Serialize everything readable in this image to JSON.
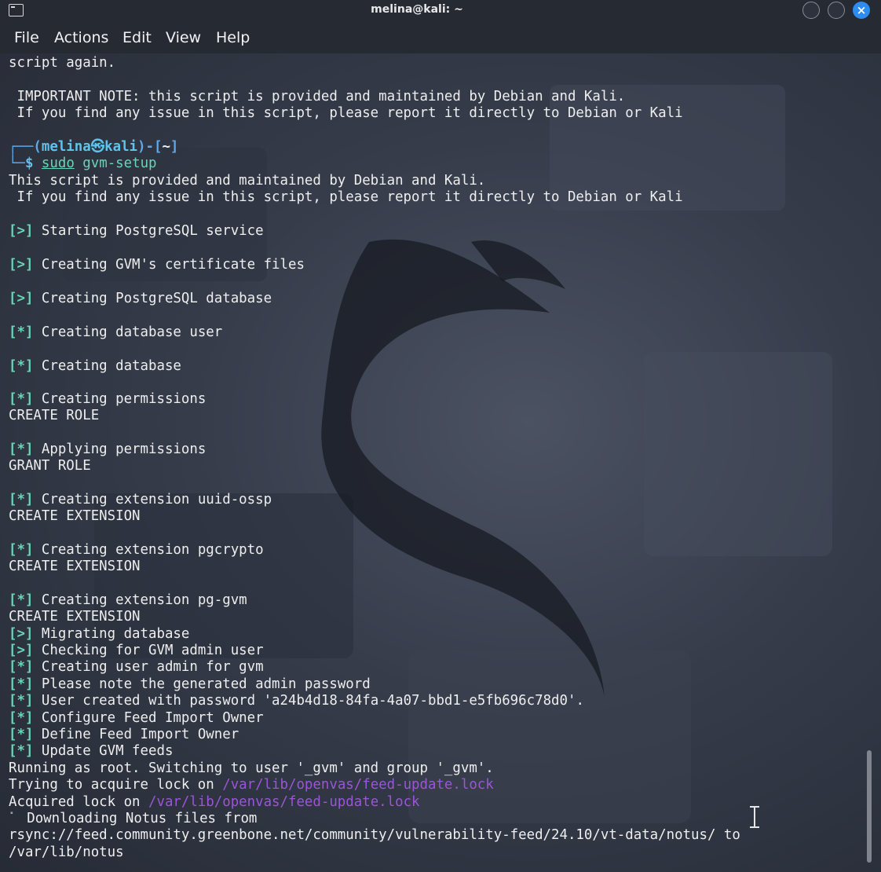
{
  "window": {
    "title": "melina@kali: ~"
  },
  "window_controls": {
    "close_glyph": "×"
  },
  "menu": [
    "File",
    "Actions",
    "Edit",
    "View",
    "Help"
  ],
  "prompt": {
    "corner_top": "┌──(",
    "user": "melina",
    "at": "㉿",
    "host": "kali",
    "dir_open": ")-[",
    "dir": "~",
    "dir_close": "]",
    "corner_bottom": "└─",
    "symbol": "$",
    "sudo": "sudo",
    "command": " gvm-setup"
  },
  "lines": {
    "l0": "script again.",
    "l1": " IMPORTANT NOTE: this script is provided and maintained by Debian and Kali.",
    "l2": " If you find any issue in this script, please report it directly to Debian or Kali",
    "l3": "This script is provided and maintained by Debian and Kali.",
    "l4": " If you find any issue in this script, please report it directly to Debian or Kali",
    "create_role": "CREATE ROLE",
    "grant_role": "GRANT ROLE",
    "create_extension": "CREATE EXTENSION",
    "running_as_root": "Running as root. Switching to user '_gvm' and group '_gvm'.",
    "trying_lock": "Trying to acquire lock on ",
    "acquired_lock": "Acquired lock on ",
    "lock_path": "/var/lib/openvas/feed-update.lock",
    "downloading": " Downloading Notus files from",
    "rsync_url": "rsync://feed.community.greenbone.net/community/vulnerability-feed/24.10/vt-data/notus/ to",
    "notus_path": "/var/lib/notus"
  },
  "steps": {
    "s1": {
      "marker": "[>]",
      "text": " Starting PostgreSQL service"
    },
    "s2": {
      "marker": "[>]",
      "text": " Creating GVM's certificate files"
    },
    "s3": {
      "marker": "[>]",
      "text": " Creating PostgreSQL database"
    },
    "s4": {
      "marker": "[*]",
      "text": " Creating database user"
    },
    "s5": {
      "marker": "[*]",
      "text": " Creating database"
    },
    "s6": {
      "marker": "[*]",
      "text": " Creating permissions"
    },
    "s7": {
      "marker": "[*]",
      "text": " Applying permissions"
    },
    "s8": {
      "marker": "[*]",
      "text": " Creating extension uuid-ossp"
    },
    "s9": {
      "marker": "[*]",
      "text": " Creating extension pgcrypto"
    },
    "s10": {
      "marker": "[*]",
      "text": " Creating extension pg-gvm"
    },
    "s11": {
      "marker": "[>]",
      "text": " Migrating database"
    },
    "s12": {
      "marker": "[>]",
      "text": " Checking for GVM admin user"
    },
    "s13": {
      "marker": "[*]",
      "text": " Creating user admin for gvm"
    },
    "s14": {
      "marker": "[*]",
      "text": " Please note the generated admin password"
    },
    "s15": {
      "marker": "[*]",
      "text": " User created with password 'a24b4d18-84fa-4a07-bbd1-e5fb696c78d0'."
    },
    "s16": {
      "marker": "[*]",
      "text": " Configure Feed Import Owner"
    },
    "s17": {
      "marker": "[*]",
      "text": " Define Feed Import Owner"
    },
    "s18": {
      "marker": "[*]",
      "text": " Update GVM feeds"
    }
  },
  "progress_glyph": "⠁",
  "colors": {
    "background": "#1f2430",
    "text": "#eeeeee",
    "prompt_cyan": "#5ec4ee",
    "prompt_blue": "#5fa8ea",
    "marker_green": "#68d5b6",
    "path_purple": "#9a55d8",
    "close_button": "#2d8cf0"
  }
}
